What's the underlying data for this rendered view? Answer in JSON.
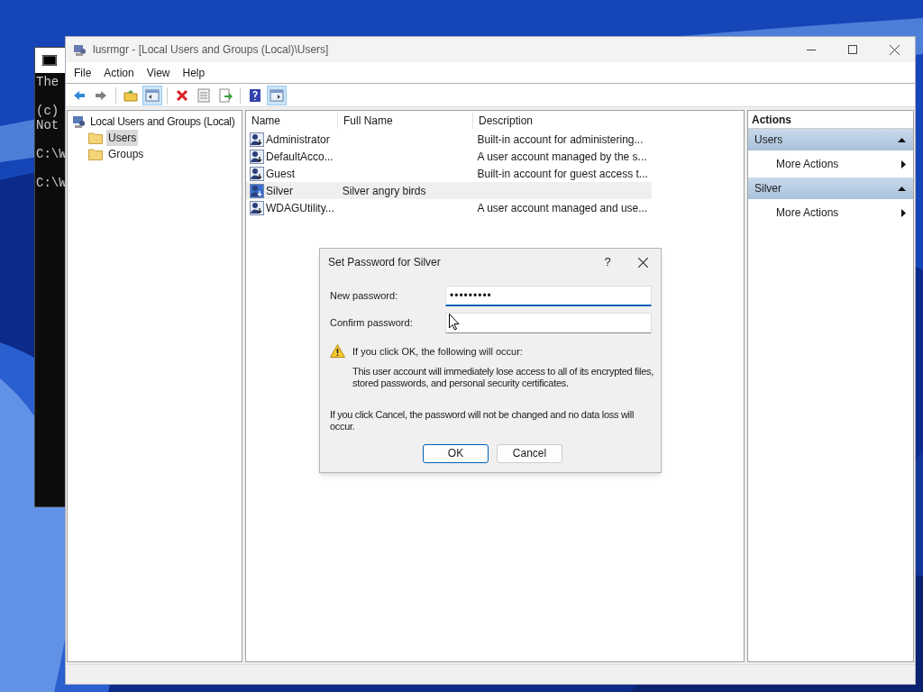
{
  "console": {
    "lines": [
      "The",
      "(c)",
      "Not",
      "C:\\W",
      "C:\\W"
    ]
  },
  "window": {
    "title": "lusrmgr - [Local Users and Groups (Local)\\Users]"
  },
  "menu": [
    "File",
    "Action",
    "View",
    "Help"
  ],
  "toolbar": [
    {
      "kind": "back",
      "pressed": false
    },
    {
      "kind": "forward",
      "pressed": false
    },
    {
      "kind": "up-folder",
      "pressed": false
    },
    {
      "kind": "tree-pane",
      "pressed": true
    },
    {
      "kind": "delete",
      "pressed": false
    },
    {
      "kind": "properties",
      "pressed": false
    },
    {
      "kind": "export",
      "pressed": false
    },
    {
      "kind": "help",
      "pressed": false
    },
    {
      "kind": "action-pane",
      "pressed": true
    }
  ],
  "tree": {
    "label": "Local Users and Groups (Local)",
    "children": [
      {
        "label": "Users",
        "selected": true
      },
      {
        "label": "Groups",
        "selected": false
      }
    ]
  },
  "table": {
    "columns": [
      "Name",
      "Full Name",
      "Description"
    ],
    "rows": [
      {
        "name": "Administrator",
        "description": "Built-in account for administering...",
        "selected": false
      },
      {
        "name": "DefaultAcco...",
        "description": "A user account managed by the s...",
        "selected": false
      },
      {
        "name": "Guest",
        "description": "Built-in account for guest access t...",
        "selected": false
      },
      {
        "name": "Silver",
        "full_name": "Silver angry birds",
        "selected": true
      },
      {
        "name": "WDAGUtility...",
        "description": "A user account managed and use...",
        "selected": false
      }
    ]
  },
  "actions": {
    "title": "Actions",
    "sections": [
      {
        "title": "Users",
        "expanded": true,
        "items": [
          "More Actions"
        ]
      },
      {
        "title": "Silver",
        "expanded": true,
        "items": [
          "More Actions"
        ]
      }
    ]
  },
  "dialog": {
    "title": "Set Password for Silver",
    "help": "?",
    "fields": [
      {
        "label": "New password:",
        "value": "•••••••••",
        "focused": true
      },
      {
        "label": "Confirm password:",
        "focused": false
      }
    ],
    "warning_title": "If you click OK, the following will occur:",
    "warning_text": "This user account will immediately lose access to all of its encrypted files, stored passwords, and personal security certificates.",
    "cancel_note": "If you click Cancel, the password will not be changed and no data loss will occur.",
    "buttons": [
      {
        "label": "OK",
        "default": true
      },
      {
        "label": "Cancel",
        "default": false
      }
    ]
  }
}
